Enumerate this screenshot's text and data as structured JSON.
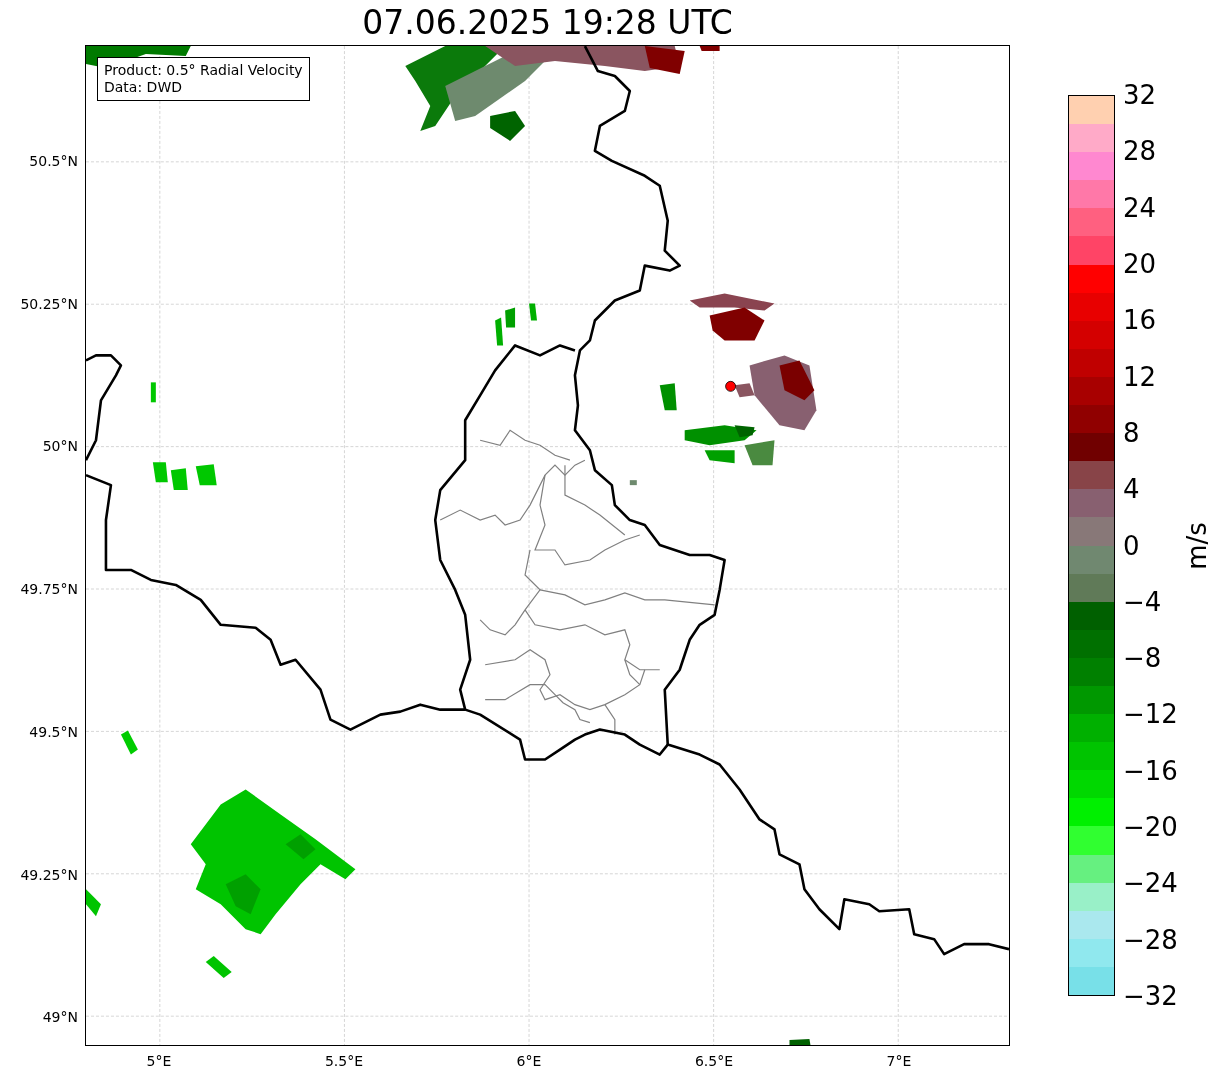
{
  "title": "07.06.2025 19:28 UTC",
  "info_box": {
    "lines": [
      "Product: 0.5° Radial Velocity",
      "Data: DWD"
    ]
  },
  "map": {
    "yticks": [
      "50.5°N",
      "50.25°N",
      "50°N",
      "49.75°N",
      "49.5°N",
      "49.25°N",
      "49°N"
    ],
    "xticks": [
      "5°E",
      "5.5°E",
      "6°E",
      "6.5°E",
      "7°E"
    ]
  },
  "colorbar": {
    "label": "m/s",
    "ticks": [
      "32",
      "28",
      "24",
      "20",
      "16",
      "12",
      "8",
      "4",
      "0",
      "−4",
      "−8",
      "−12",
      "−16",
      "−20",
      "−24",
      "−28",
      "−32"
    ],
    "segments": [
      {
        "color": "#ffd0b0"
      },
      {
        "color": "#ffaac8"
      },
      {
        "color": "#ff88d0"
      },
      {
        "color": "#ff78a8"
      },
      {
        "color": "#ff6080"
      },
      {
        "color": "#ff4466"
      },
      {
        "color": "#ff0000"
      },
      {
        "color": "#e80000"
      },
      {
        "color": "#d40000"
      },
      {
        "color": "#c00000"
      },
      {
        "color": "#a80000"
      },
      {
        "color": "#900000"
      },
      {
        "color": "#700000"
      },
      {
        "color": "#884448"
      },
      {
        "color": "#886070"
      },
      {
        "color": "#887878"
      },
      {
        "color": "#708870"
      },
      {
        "color": "#607a58"
      },
      {
        "color": "#006000"
      },
      {
        "color": "#007000"
      },
      {
        "color": "#008000"
      },
      {
        "color": "#009800"
      },
      {
        "color": "#00b000"
      },
      {
        "color": "#00c400"
      },
      {
        "color": "#00d800"
      },
      {
        "color": "#00f000"
      },
      {
        "color": "#30ff30"
      },
      {
        "color": "#66f080"
      },
      {
        "color": "#99f0c8"
      },
      {
        "color": "#aae8ee"
      },
      {
        "color": "#90e8ee"
      },
      {
        "color": "#78e0e8"
      }
    ]
  }
}
